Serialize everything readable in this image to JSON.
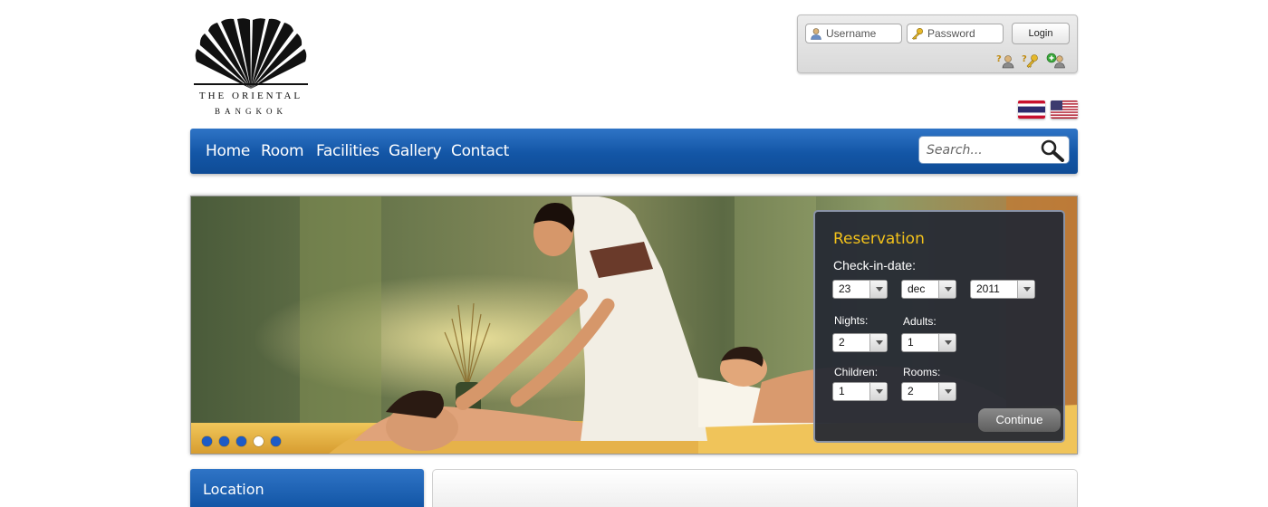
{
  "logo": {
    "line1": "THE ORIENTAL",
    "line2": "BANGKOK"
  },
  "login": {
    "username_placeholder": "Username",
    "password_placeholder": "Password",
    "login_label": "Login",
    "icons": [
      "forgot-username-icon",
      "forgot-password-icon",
      "register-icon"
    ]
  },
  "flags": [
    "thai-flag-icon",
    "us-flag-icon"
  ],
  "nav": {
    "items": [
      {
        "label": "Home"
      },
      {
        "label": "Room"
      },
      {
        "label": "Facilities"
      },
      {
        "label": "Gallery"
      },
      {
        "label": "Contact"
      }
    ],
    "search_placeholder": "Search..."
  },
  "slider": {
    "slide_count": 5,
    "active_index": 3
  },
  "reservation": {
    "title": "Reservation",
    "checkin_label": "Check-in-date:",
    "day": "23",
    "month": "dec",
    "year": "2011",
    "nights_label": "Nights:",
    "nights": "2",
    "adults_label": "Adults:",
    "adults": "1",
    "children_label": "Children:",
    "children": "1",
    "rooms_label": "Rooms:",
    "rooms": "2",
    "continue_label": "Continue"
  },
  "sidebar": {
    "location_title": "Location"
  },
  "colors": {
    "nav_blue": "#1356a6",
    "reservation_title": "#f3c21b",
    "dot_blue": "#1d5bc6"
  }
}
